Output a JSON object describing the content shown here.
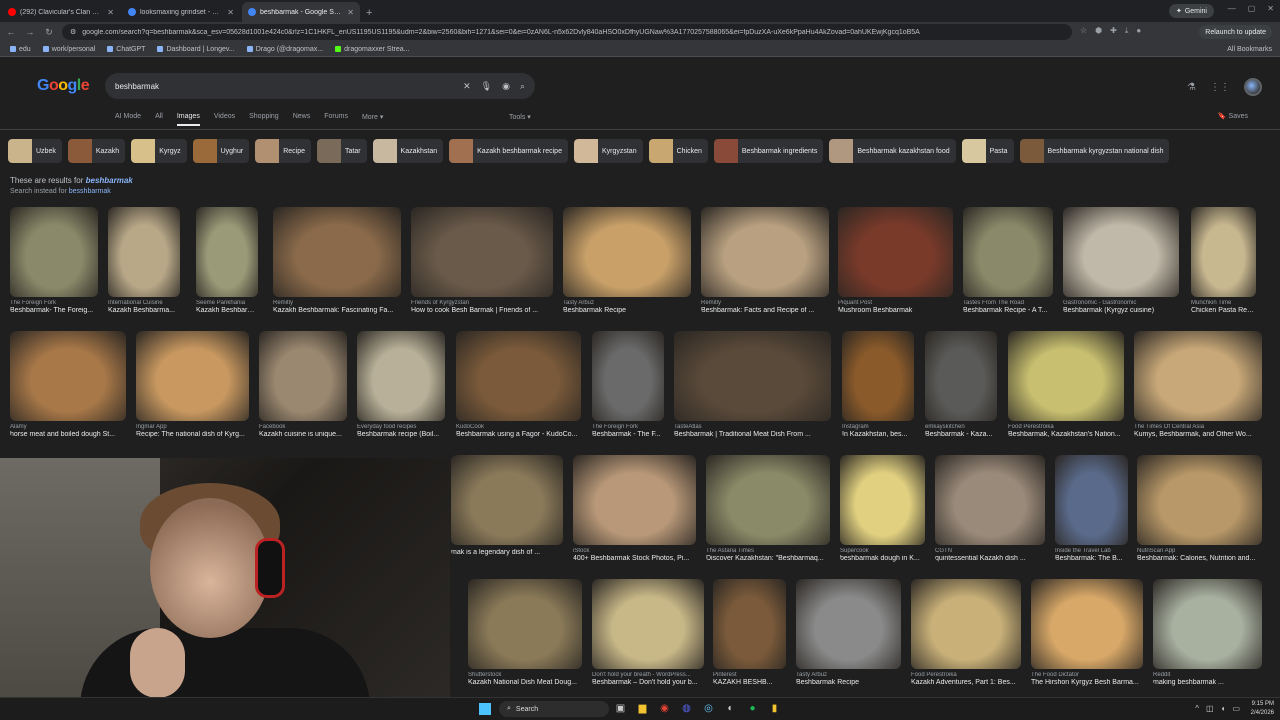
{
  "browser": {
    "tabs": [
      {
        "title": "(292) Clavicular's Clan Commu",
        "active": false,
        "color": "#ff0000"
      },
      {
        "title": "looksmaxing grindset - Google S",
        "active": false,
        "color": "#4285f4"
      },
      {
        "title": "beshbarmak - Google Search",
        "active": true,
        "color": "#4285f4"
      }
    ],
    "gemini_label": "Gemini",
    "url": "google.com/search?q=beshbarmak&sca_esv=05628d1001e424c0&rlz=1C1HKFL_enUS1195US1195&udm=2&biw=2560&bih=1271&sei=0&ei=0zAN6L-n5x62Dvly840aHSO0xDfhyUGNaw%3A1770257588065&ei=fpDuzXA-uXe6kPpaHu4AkZovad=0ahUKEwjKgcq1oB5A",
    "relaunch_label": "Relaunch to update",
    "bookmarks": [
      "edu",
      "work/personal",
      "ChatGPT",
      "Dashboard | Longev...",
      "Drago (@dragomax...",
      "dragomaxxer Strea..."
    ],
    "all_bookmarks_label": "All Bookmarks"
  },
  "google": {
    "logo_text": "Google",
    "query": "beshbarmak",
    "nav_tabs": [
      "AI Mode",
      "All",
      "Images",
      "Videos",
      "Shopping",
      "News",
      "Forums",
      "More"
    ],
    "active_tab": "Images",
    "tools_label": "Tools",
    "saves_label": "Saves",
    "chips": [
      {
        "label": "Uzbek",
        "color": "#c9b48c"
      },
      {
        "label": "Kazakh",
        "color": "#8a5a3a"
      },
      {
        "label": "Kyrgyz",
        "color": "#d8c08a"
      },
      {
        "label": "Uyghur",
        "color": "#9a6a3a"
      },
      {
        "label": "Recipe",
        "color": "#b09070"
      },
      {
        "label": "Tatar",
        "color": "#7a6a5a"
      },
      {
        "label": "Kazakhstan",
        "color": "#c8b8a0"
      },
      {
        "label": "Kazakh beshbarmak recipe",
        "color": "#a07050"
      },
      {
        "label": "Kyrgyzstan",
        "color": "#d0b898"
      },
      {
        "label": "Chicken",
        "color": "#c8a870"
      },
      {
        "label": "Beshbarmak ingredients",
        "color": "#8a4a3a"
      },
      {
        "label": "Beshbarmak kazakhstan food",
        "color": "#b09880"
      },
      {
        "label": "Pasta",
        "color": "#d8c8a0"
      },
      {
        "label": "Beshbarmak kyrgyzstan national dish",
        "color": "#7a5a3a"
      }
    ],
    "results_for_prefix": "These are results for",
    "results_for_term": "beshbarmak",
    "search_instead_prefix": "Search instead for",
    "search_instead_term": "besshbarmak",
    "images": [
      {
        "source": "The Foreign Fork",
        "caption": "Beshbarmak- The Foreig...",
        "color": "#8a8a6a"
      },
      {
        "source": "International Cuisine",
        "caption": "Kazakh Beshbarma...",
        "color": "#b8a888"
      },
      {
        "source": "Seeme Pankhania",
        "caption": "Kazakh Beshbarma...",
        "color": "#9a9a78"
      },
      {
        "source": "Remitly",
        "caption": "Kazakh Beshbarmak: Fascinating Fa...",
        "color": "#8a6a4a"
      },
      {
        "source": "Friends of Kyrgyzstan",
        "caption": "How to cook Besh Barmak | Friends of ...",
        "color": "#6a5a4a"
      },
      {
        "source": "Tasty Arbuz",
        "caption": "Beshbarmak Recipe",
        "color": "#c8a068"
      },
      {
        "source": "Remitly",
        "caption": "Beshbarmak: Facts and Recipe of ...",
        "color": "#b8a080"
      },
      {
        "source": "Piquant Post",
        "caption": "Mushroom Beshbarmak",
        "color": "#7a3a2a"
      },
      {
        "source": "Tastes From The Road",
        "caption": "Beshbarmak Recipe - A T...",
        "color": "#8a8a6a"
      },
      {
        "source": "Gastronomic - Gastronomic",
        "caption": "Beshbarmak (Kyrgyz cuisine)",
        "color": "#c0b8a8"
      },
      {
        "source": "Munchkin Time",
        "caption": "Chicken Pasta Reci...",
        "color": "#c8b890"
      },
      {
        "source": "Alamy",
        "caption": "horse meat and boiled dough St...",
        "color": "#a87848"
      },
      {
        "source": "Ingmar App",
        "caption": "Recipe: The national dish of Kyrg...",
        "color": "#c89860"
      },
      {
        "source": "Facebook",
        "caption": "Kazakh cuisine is unique...",
        "color": "#9a8870"
      },
      {
        "source": "Everyday food recipes",
        "caption": "Beshbarmak recipe (Boil...",
        "color": "#b8b098"
      },
      {
        "source": "KudoCook",
        "caption": "Beshbarmak using a Fagor - KudoCo...",
        "color": "#7a5a3a"
      },
      {
        "source": "The Foreign Fork",
        "caption": "Beshbarmak - The F...",
        "color": "#6a6a6a"
      },
      {
        "source": "TasteAtlas",
        "caption": "Beshbarmak | Traditional Meat Dish From ...",
        "color": "#5a4a3a"
      },
      {
        "source": "Instagram",
        "caption": "In Kazakhstan, bes...",
        "color": "#8a5a2a"
      },
      {
        "source": "emkayskitchen",
        "caption": "Beshbarmak - Kaza...",
        "color": "#5a5a58"
      },
      {
        "source": "Food Perestroika",
        "caption": "Beshbarmak, Kazakhstan's Nation...",
        "color": "#c8c070"
      },
      {
        "source": "The Times Of Central Asia",
        "caption": "Kumys, Beshbarmak, and Other Wo...",
        "color": "#c8a878"
      },
      {
        "source": "",
        "caption": "mak is a legendary dish of ...",
        "color": "#8a7a5a"
      },
      {
        "source": "iStock",
        "caption": "400+ Beshbarmak Stock Photos, Pi...",
        "color": "#b89878"
      },
      {
        "source": "The Astana Times",
        "caption": "Discover Kazakhstan: \"Beshbarmaq...",
        "color": "#8a8a68"
      },
      {
        "source": "Supercook",
        "caption": "beshbarmak dough in K...",
        "color": "#e0d080"
      },
      {
        "source": "CGTN",
        "caption": "quintessential Kazakh dish ...",
        "color": "#9a8a7a"
      },
      {
        "source": "Inside the Travel Lab",
        "caption": "Beshbarmak: The B...",
        "color": "#5a6a8a"
      },
      {
        "source": "NutriScan App",
        "caption": "Beshbarmak: Calories, Nutrition and...",
        "color": "#b89868"
      },
      {
        "source": "Shutterstock",
        "caption": "Kazakh National Dish Meat Doug...",
        "color": "#8a7a58"
      },
      {
        "source": "Don't hold your breath - WordPress...",
        "caption": "Beshbarmak – Don't hold your b...",
        "color": "#c8b888"
      },
      {
        "source": "Pinterest",
        "caption": "KAZAKH BESHB...",
        "color": "#7a5a3a"
      },
      {
        "source": "Tasty Arbuz",
        "caption": "Beshbarmak Recipe",
        "color": "#8a8a8a"
      },
      {
        "source": "Food Perestroika",
        "caption": "Kazakh Adventures, Part 1: Bes...",
        "color": "#c8b078"
      },
      {
        "source": "The Food Dictator",
        "caption": "The Hirshon Kyrgyz Besh Barma...",
        "color": "#d8a868"
      },
      {
        "source": "Reddit",
        "caption": "making beshbarmak ...",
        "color": "#a8b0a0"
      }
    ]
  },
  "taskbar": {
    "search_label": "Search",
    "time": "9:15 PM",
    "date": "2/4/2026"
  }
}
